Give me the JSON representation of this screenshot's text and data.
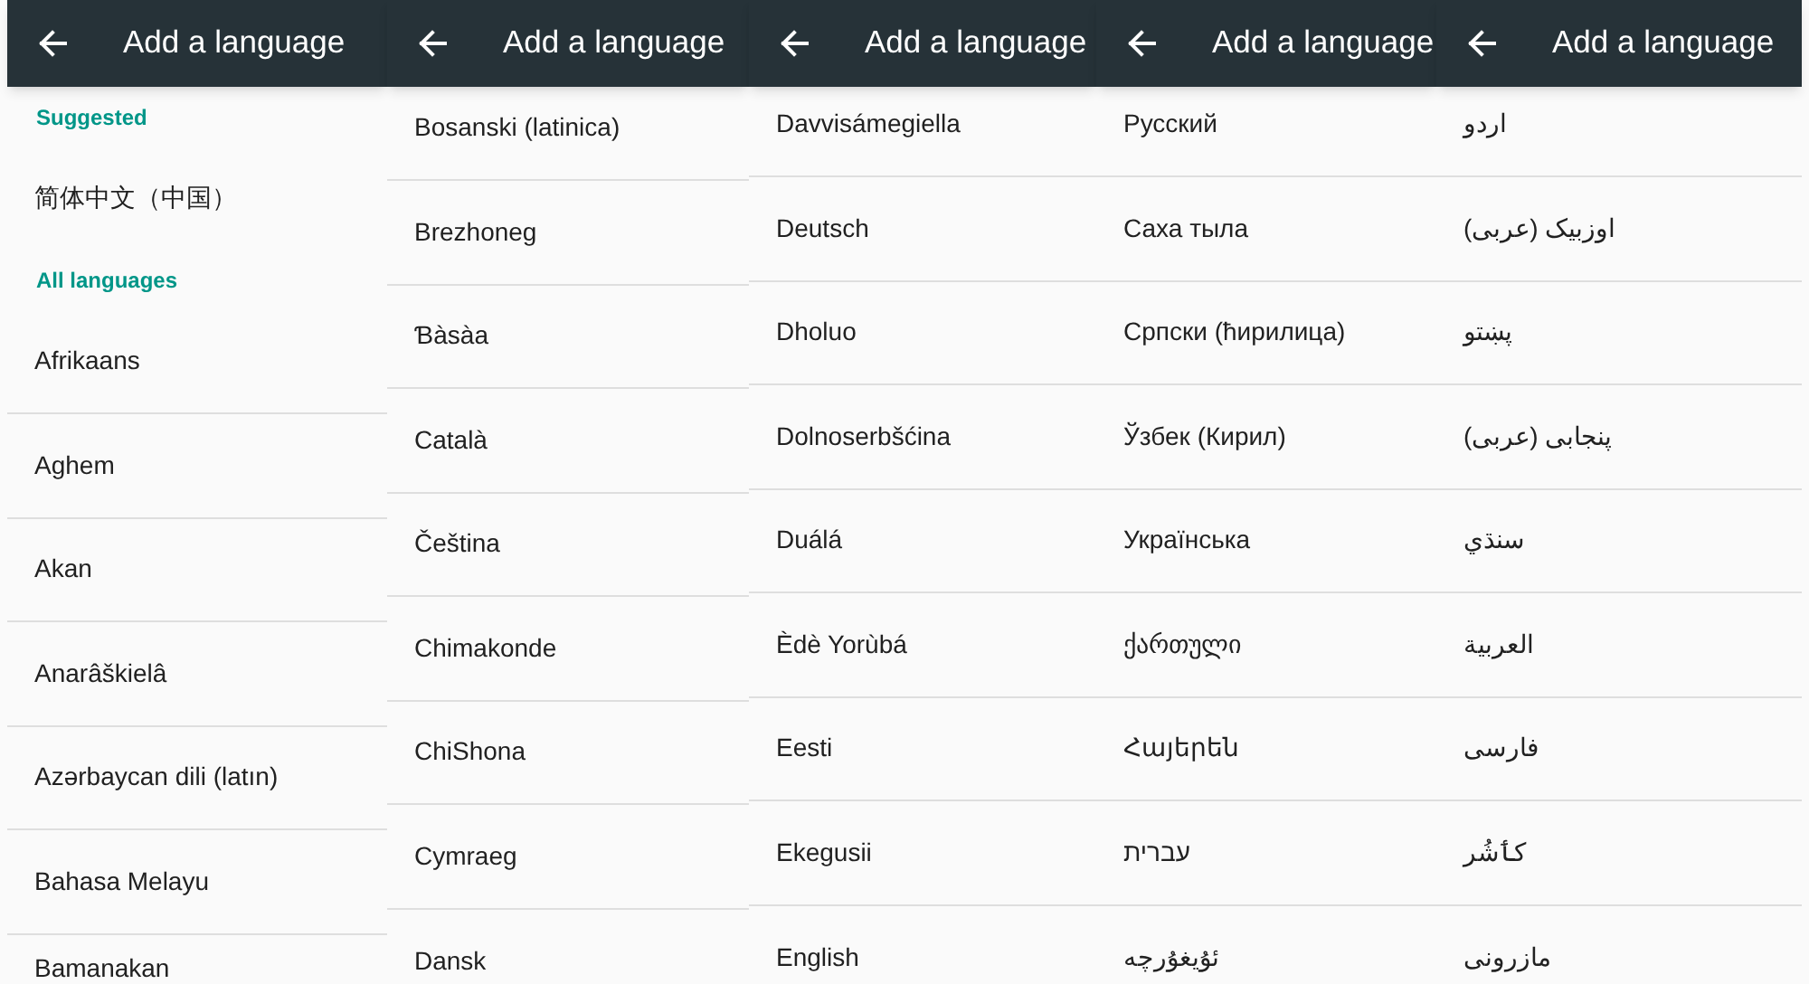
{
  "panels": [
    {
      "title": "Add a language",
      "items": [
        {
          "kind": "subheader",
          "label": "Suggested"
        },
        {
          "kind": "language",
          "label": "简体中文（中国）"
        },
        {
          "kind": "subheader",
          "label": "All languages"
        },
        {
          "kind": "language",
          "label": "Afrikaans"
        },
        {
          "kind": "language",
          "label": "Aghem"
        },
        {
          "kind": "language",
          "label": "Akan"
        },
        {
          "kind": "language",
          "label": "Anarâškielâ"
        },
        {
          "kind": "language",
          "label": "Azərbaycan dili (latın)"
        },
        {
          "kind": "language",
          "label": "Bahasa Melayu"
        },
        {
          "kind": "language",
          "label": "Bamanakan"
        }
      ]
    },
    {
      "title": "Add a language",
      "items": [
        {
          "kind": "language",
          "label": "Bosanski (latinica)"
        },
        {
          "kind": "language",
          "label": "Brezhoneg"
        },
        {
          "kind": "language",
          "label": "Ɓàsàa"
        },
        {
          "kind": "language",
          "label": "Català"
        },
        {
          "kind": "language",
          "label": "Čeština"
        },
        {
          "kind": "language",
          "label": "Chimakonde"
        },
        {
          "kind": "language",
          "label": "ChiShona"
        },
        {
          "kind": "language",
          "label": "Cymraeg"
        },
        {
          "kind": "language",
          "label": "Dansk"
        }
      ]
    },
    {
      "title": "Add a language",
      "items": [
        {
          "kind": "language",
          "label": "Davvisámegiella"
        },
        {
          "kind": "language",
          "label": "Deutsch"
        },
        {
          "kind": "language",
          "label": "Dholuo"
        },
        {
          "kind": "language",
          "label": "Dolnoserbšćina"
        },
        {
          "kind": "language",
          "label": "Duálá"
        },
        {
          "kind": "language",
          "label": "Èdè Yorùbá"
        },
        {
          "kind": "language",
          "label": "Eesti"
        },
        {
          "kind": "language",
          "label": "Ekegusii"
        },
        {
          "kind": "language",
          "label": "English"
        }
      ]
    },
    {
      "title": "Add a language",
      "items": [
        {
          "kind": "language",
          "label": "Русский"
        },
        {
          "kind": "language",
          "label": "Саха тыла"
        },
        {
          "kind": "language",
          "label": "Српски (ћирилица)"
        },
        {
          "kind": "language",
          "label": "Ўзбек (Кирил)"
        },
        {
          "kind": "language",
          "label": "Українська"
        },
        {
          "kind": "language",
          "label": "ქართული"
        },
        {
          "kind": "language",
          "label": "Հայերեն"
        },
        {
          "kind": "language",
          "label": "עברית"
        },
        {
          "kind": "language",
          "label": "ئۇيغۇرچە"
        }
      ]
    },
    {
      "title": "Add a language",
      "items": [
        {
          "kind": "language",
          "label": "اردو"
        },
        {
          "kind": "language",
          "label": "اوزبیک (عربی)"
        },
        {
          "kind": "language",
          "label": "پښتو"
        },
        {
          "kind": "language",
          "label": "پنجابی (عربی)"
        },
        {
          "kind": "language",
          "label": "سنڌي"
        },
        {
          "kind": "language",
          "label": "العربية"
        },
        {
          "kind": "language",
          "label": "فارسی"
        },
        {
          "kind": "language",
          "label": "کٲشُر"
        },
        {
          "kind": "language",
          "label": "مازرونی"
        }
      ]
    }
  ]
}
